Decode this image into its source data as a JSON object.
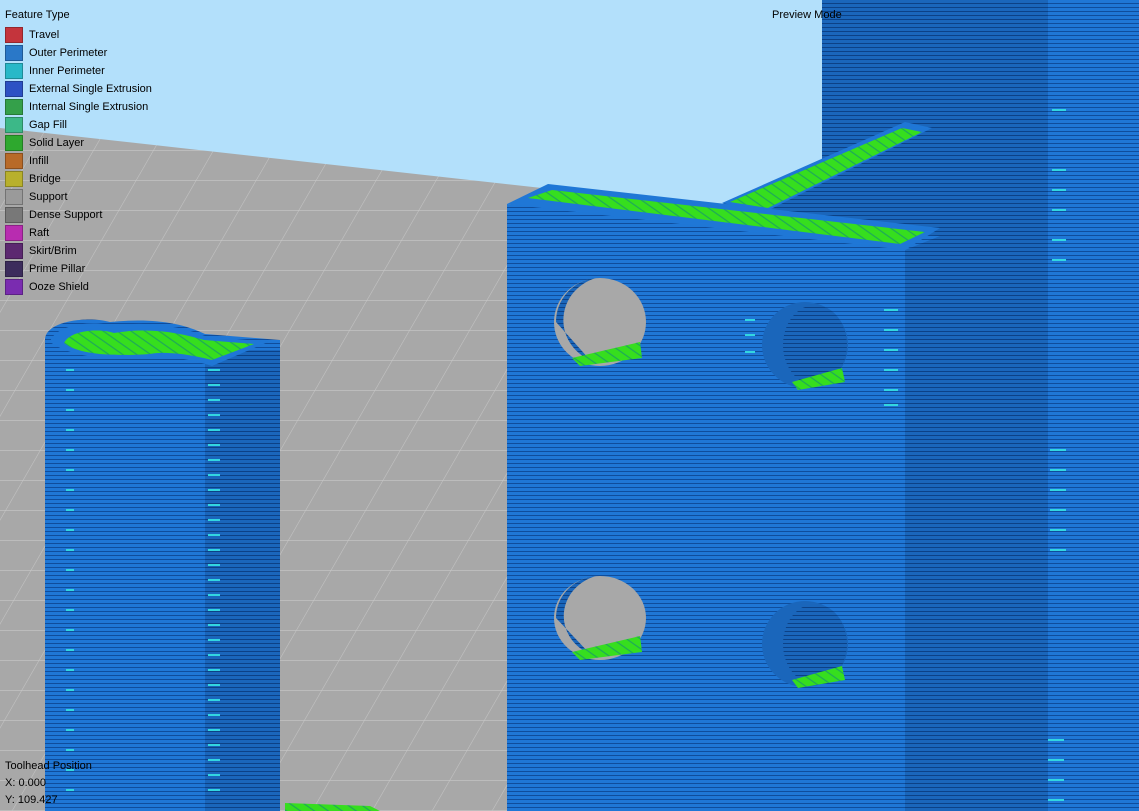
{
  "legend": {
    "title": "Feature Type",
    "items": [
      {
        "label": "Travel",
        "color": "#c4343c"
      },
      {
        "label": "Outer Perimeter",
        "color": "#2a78c8"
      },
      {
        "label": "Inner Perimeter",
        "color": "#28b8c8"
      },
      {
        "label": "External Single Extrusion",
        "color": "#2c52c4"
      },
      {
        "label": "Internal Single Extrusion",
        "color": "#34a04a"
      },
      {
        "label": "Gap Fill",
        "color": "#3cb888"
      },
      {
        "label": "Solid Layer",
        "color": "#2ea82e"
      },
      {
        "label": "Infill",
        "color": "#b86a28"
      },
      {
        "label": "Bridge",
        "color": "#b8b02c"
      },
      {
        "label": "Support",
        "color": "#9a9a9a"
      },
      {
        "label": "Dense Support",
        "color": "#787878"
      },
      {
        "label": "Raft",
        "color": "#b82cb0"
      },
      {
        "label": "Skirt/Brim",
        "color": "#5c2870"
      },
      {
        "label": "Prime Pillar",
        "color": "#3c2c5c"
      },
      {
        "label": "Ooze Shield",
        "color": "#7a2cb0"
      }
    ]
  },
  "mode_label": "Preview Mode",
  "toolhead": {
    "title": "Toolhead Position",
    "x": "X: 0.000",
    "y": "Y: 109.427"
  },
  "colors": {
    "sky": "#b3e0fb",
    "bed": "#a8a8a8",
    "part_blue": "#1f77d6",
    "top_green": "#33dd22"
  }
}
